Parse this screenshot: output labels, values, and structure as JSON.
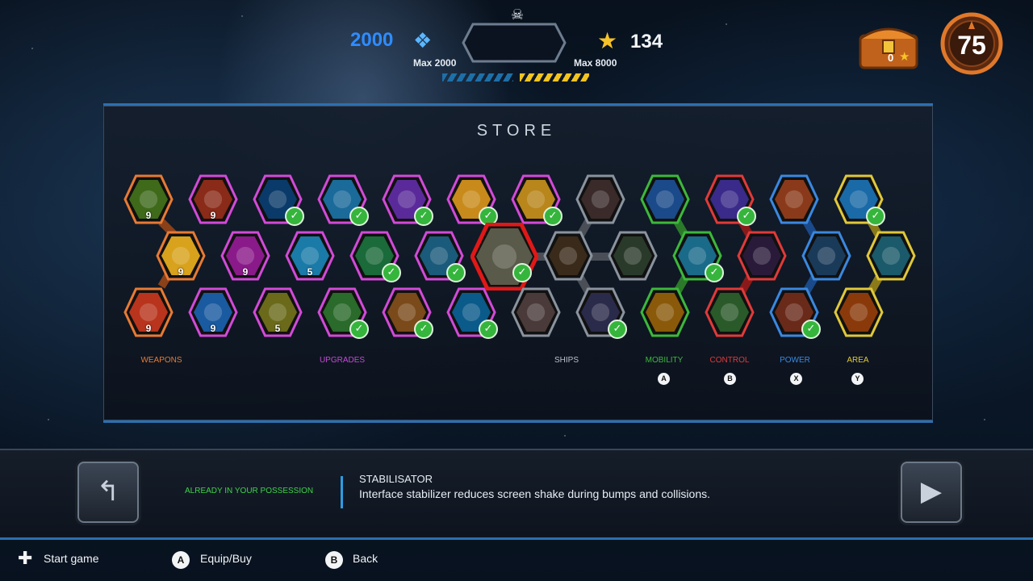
{
  "hud": {
    "crystals": "2000",
    "crystals_max": "Max 2000",
    "stars": "134",
    "stars_max": "Max 8000",
    "chest_count": "0",
    "level": "75"
  },
  "store": {
    "title": "STORE",
    "categories": [
      {
        "label": "WEAPONS",
        "color": "#e87a34"
      },
      {
        "label": "UPGRADES",
        "color": "#c44ad6"
      },
      {
        "label": "SHIPS",
        "color": "#b9c1ca"
      },
      {
        "label": "MOBILITY",
        "color": "#3cb83c",
        "button": "A"
      },
      {
        "label": "CONTROL",
        "color": "#e03a3a",
        "button": "B"
      },
      {
        "label": "POWER",
        "color": "#3a88e0",
        "button": "X"
      },
      {
        "label": "AREA",
        "color": "#e0c83a",
        "button": "Y"
      }
    ],
    "tiles": [
      {
        "name": "weapon-1",
        "border": "#e87a34",
        "fill": "#3e6a1a",
        "count": "9",
        "owned": false
      },
      {
        "name": "weapon-2",
        "border": "#e87a34",
        "fill": "#d8a21c",
        "count": "9",
        "owned": false
      },
      {
        "name": "weapon-3",
        "border": "#e87a34",
        "fill": "#b9341c",
        "count": "9",
        "owned": false
      },
      {
        "name": "weapon-4",
        "border": "#d24ad8",
        "fill": "#8a2a18",
        "count": "9",
        "owned": false
      },
      {
        "name": "weapon-5",
        "border": "#d24ad8",
        "fill": "#8a1a8a",
        "count": "9",
        "owned": false
      },
      {
        "name": "weapon-6",
        "border": "#d24ad8",
        "fill": "#1a5aa0",
        "count": "9",
        "owned": false
      },
      {
        "name": "weapon-7",
        "border": "#d24ad8",
        "fill": "#1a7aa8",
        "count": "5",
        "owned": false
      },
      {
        "name": "weapon-8",
        "border": "#d24ad8",
        "fill": "#6a6a1a",
        "count": "5",
        "owned": false
      },
      {
        "name": "upgrade-1",
        "border": "#d24ad8",
        "fill": "#0a3a6a",
        "count": "",
        "owned": true
      },
      {
        "name": "upgrade-2",
        "border": "#d24ad8",
        "fill": "#1a6a9a",
        "count": "",
        "owned": true
      },
      {
        "name": "upgrade-3",
        "border": "#d24ad8",
        "fill": "#1a6a3a",
        "count": "",
        "owned": true
      },
      {
        "name": "upgrade-4",
        "border": "#d24ad8",
        "fill": "#2a6a2a",
        "count": "",
        "owned": true
      },
      {
        "name": "upgrade-5",
        "border": "#d24ad8",
        "fill": "#5a2a9a",
        "count": "",
        "owned": true
      },
      {
        "name": "upgrade-6",
        "border": "#d24ad8",
        "fill": "#1a5a7a",
        "count": "",
        "owned": true
      },
      {
        "name": "upgrade-7",
        "border": "#d24ad8",
        "fill": "#7a4a1a",
        "count": "",
        "owned": true
      },
      {
        "name": "upgrade-8",
        "border": "#d24ad8",
        "fill": "#c88a1a",
        "count": "",
        "owned": true
      },
      {
        "name": "upgrade-9",
        "border": "#d24ad8",
        "fill": "#b8861a",
        "count": "",
        "owned": true
      },
      {
        "name": "upgrade-10",
        "border": "#d24ad8",
        "fill": "#0a5a8a",
        "count": "",
        "owned": true
      },
      {
        "name": "upgrade-stabilisator",
        "border": "#e01818",
        "fill": "#5a5a4a",
        "count": "",
        "owned": true,
        "selected": true
      },
      {
        "name": "ship-1",
        "border": "#8a939e",
        "fill": "#3a2a2a",
        "count": "",
        "owned": false
      },
      {
        "name": "ship-2",
        "border": "#8a939e",
        "fill": "#3a2a1a",
        "count": "",
        "owned": false
      },
      {
        "name": "ship-3",
        "border": "#8a939e",
        "fill": "#2a3a2a",
        "count": "",
        "owned": false
      },
      {
        "name": "ship-4",
        "border": "#8a939e",
        "fill": "#4a3a3a",
        "count": "",
        "owned": false
      },
      {
        "name": "ship-5",
        "border": "#8a939e",
        "fill": "#2a2a4a",
        "count": "",
        "owned": true
      },
      {
        "name": "mobility-1",
        "border": "#3cb83c",
        "fill": "#1a4a8a",
        "count": "",
        "owned": false
      },
      {
        "name": "mobility-2",
        "border": "#3cb83c",
        "fill": "#1a6a8a",
        "count": "",
        "owned": true
      },
      {
        "name": "mobility-3",
        "border": "#3cb83c",
        "fill": "#8a5a0a",
        "count": "",
        "owned": false
      },
      {
        "name": "control-1",
        "border": "#e03a3a",
        "fill": "#3a2a8a",
        "count": "",
        "owned": true
      },
      {
        "name": "control-2",
        "border": "#e03a3a",
        "fill": "#2a1a3a",
        "count": "",
        "owned": false
      },
      {
        "name": "control-3",
        "border": "#e03a3a",
        "fill": "#2a5a2a",
        "count": "",
        "owned": false
      },
      {
        "name": "power-1",
        "border": "#3a88e0",
        "fill": "#8a3a1a",
        "count": "",
        "owned": false
      },
      {
        "name": "power-2",
        "border": "#3a88e0",
        "fill": "#1a3a5a",
        "count": "",
        "owned": false
      },
      {
        "name": "power-3",
        "border": "#3a88e0",
        "fill": "#6a2a1a",
        "count": "",
        "owned": true
      },
      {
        "name": "area-1",
        "border": "#e0c83a",
        "fill": "#1a6aa8",
        "count": "",
        "owned": true
      },
      {
        "name": "area-2",
        "border": "#e0c83a",
        "fill": "#1a5a6a",
        "count": "",
        "owned": false
      },
      {
        "name": "area-3",
        "border": "#e0c83a",
        "fill": "#8a3a0a",
        "count": "",
        "owned": false
      }
    ]
  },
  "info": {
    "status": "ALREADY IN YOUR POSSESSION",
    "item_name": "STABILISATOR",
    "item_description": "Interface stabilizer reduces screen shake during bumps and collisions."
  },
  "controls": {
    "start": "Start game",
    "equip_button": "A",
    "equip": "Equip/Buy",
    "back_button": "B",
    "back": "Back"
  },
  "icons": {
    "skull": "skull-icon",
    "crystal": "crystal-icon",
    "star": "star-icon",
    "chest": "chest-icon",
    "prev": "back-arrow-icon",
    "next": "play-arrow-icon"
  }
}
